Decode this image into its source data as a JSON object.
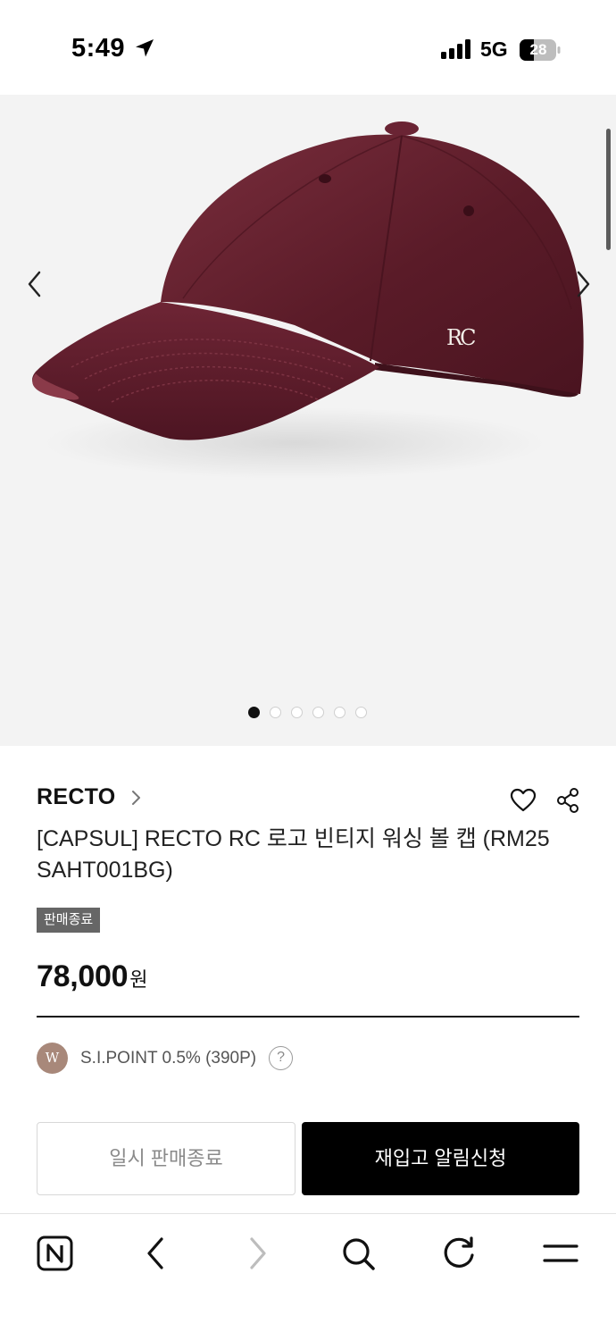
{
  "status_bar": {
    "time": "5:49",
    "network": "5G",
    "battery": "28"
  },
  "gallery": {
    "image_logo_text": "RC",
    "total_images": 6,
    "current_index": 1
  },
  "product": {
    "brand": "RECTO",
    "title": "[CAPSUL] RECTO RC 로고 빈티지 워싱 볼 캡 (RM25 SAHT001BG)",
    "status_badge": "판매종료",
    "price": "78,000",
    "price_unit": "원"
  },
  "point": {
    "badge_letter": "W",
    "text": "S.I.POINT 0.5% (390P)",
    "help": "?"
  },
  "actions": {
    "temp_soldout_label": "일시 판매종료",
    "restock_label": "재입고 알림신청"
  },
  "browser_bar": {
    "icons": [
      "naver-icon",
      "back-icon",
      "forward-icon",
      "search-icon",
      "refresh-icon",
      "menu-icon"
    ]
  },
  "colors": {
    "cap": "#5e1f2c",
    "badge_bg": "#666666",
    "point_badge": "#a8887a",
    "cta_bg": "#000000"
  }
}
